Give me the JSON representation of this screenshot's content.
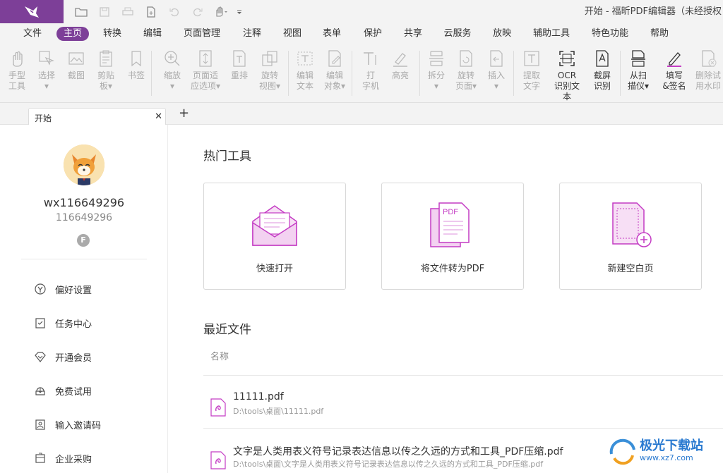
{
  "titlebar": {
    "title": "开始 - 福昕PDF编辑器（未经授权"
  },
  "menu": {
    "items": [
      "文件",
      "主页",
      "转换",
      "编辑",
      "页面管理",
      "注释",
      "视图",
      "表单",
      "保护",
      "共享",
      "云服务",
      "放映",
      "辅助工具",
      "特色功能",
      "帮助"
    ],
    "active": "主页"
  },
  "ribbon": {
    "items": [
      {
        "label": "手型\n工具",
        "icon": "hand-icon"
      },
      {
        "label": "选择\n▾",
        "icon": "select-cursor-icon"
      },
      {
        "label": "截图",
        "icon": "snapshot-icon"
      },
      {
        "label": "剪贴\n板▾",
        "icon": "clipboard-icon"
      },
      {
        "label": "书签",
        "icon": "bookmark-icon"
      },
      {
        "label": "缩放\n▾",
        "icon": "zoom-icon"
      },
      {
        "label": "页面适\n应选项▾",
        "icon": "fit-page-icon"
      },
      {
        "label": "重排",
        "icon": "reflow-icon"
      },
      {
        "label": "旋转\n视图▾",
        "icon": "rotate-view-icon"
      },
      {
        "label": "编辑\n文本",
        "icon": "edit-text-icon"
      },
      {
        "label": "编辑\n对象▾",
        "icon": "edit-object-icon"
      },
      {
        "label": "打\n字机",
        "icon": "typewriter-icon"
      },
      {
        "label": "高亮",
        "icon": "highlight-icon"
      },
      {
        "label": "拆分\n▾",
        "icon": "split-icon"
      },
      {
        "label": "旋转\n页面▾",
        "icon": "rotate-page-icon"
      },
      {
        "label": "插入\n▾",
        "icon": "insert-icon"
      },
      {
        "label": "提取\n文字",
        "icon": "extract-text-icon"
      },
      {
        "label": "OCR\n识别文本",
        "icon": "ocr-icon"
      },
      {
        "label": "截屏\n识别",
        "icon": "screen-capture-ocr-icon"
      },
      {
        "label": "从扫\n描仪▾",
        "icon": "scanner-icon"
      },
      {
        "label": "填写\n&签名",
        "icon": "fill-sign-icon"
      },
      {
        "label": "删除试\n用水印",
        "icon": "remove-watermark-icon"
      }
    ]
  },
  "tabs": {
    "active_label": "开始",
    "close": "✕",
    "add": "+"
  },
  "user": {
    "name": "wx116649296",
    "id": "116649296",
    "badge": "F"
  },
  "sidebar": {
    "items": [
      {
        "label": "偏好设置",
        "icon": "settings-icon"
      },
      {
        "label": "任务中心",
        "icon": "task-center-icon"
      },
      {
        "label": "开通会员",
        "icon": "vip-icon"
      },
      {
        "label": "免费试用",
        "icon": "free-trial-icon"
      },
      {
        "label": "输入邀请码",
        "icon": "invite-code-icon"
      },
      {
        "label": "企业采购",
        "icon": "enterprise-icon"
      }
    ]
  },
  "main": {
    "hot_tools_title": "热门工具",
    "cards": [
      {
        "label": "快速打开",
        "icon": "quick-open-envelope-icon"
      },
      {
        "label": "将文件转为PDF",
        "icon": "convert-to-pdf-icon"
      },
      {
        "label": "新建空白页",
        "icon": "new-blank-page-icon"
      }
    ],
    "recent_title": "最近文件",
    "column_name": "名称",
    "files": [
      {
        "name": "11111.pdf",
        "path": "D:\\tools\\桌面\\11111.pdf"
      },
      {
        "name": "文字是人类用表义符号记录表达信息以传之久远的方式和工具_PDF压缩.pdf",
        "path": "D:\\tools\\桌面\\文字是人类用表义符号记录表达信息以传之久远的方式和工具_PDF压缩.pdf"
      }
    ]
  },
  "watermark": {
    "text": "极光下载站",
    "url": "www.xz7.com"
  },
  "colors": {
    "accent": "#7d3f98",
    "pink": "#c43cc4",
    "chrome": "#f3f3f3"
  }
}
